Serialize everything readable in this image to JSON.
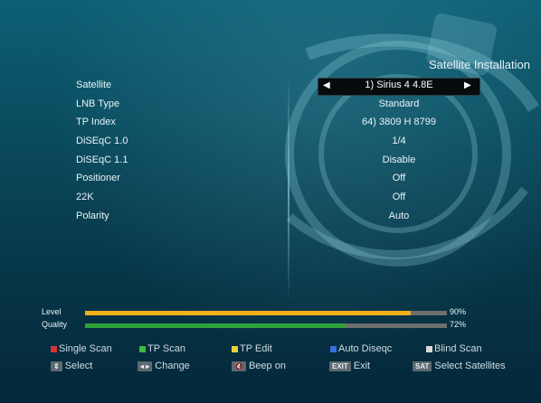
{
  "header": {
    "title": "Satellite Installation"
  },
  "settings": [
    {
      "label": "Satellite",
      "value": "1) Sirius 4 4.8E",
      "selected": true
    },
    {
      "label": "LNB Type",
      "value": "Standard"
    },
    {
      "label": "TP Index",
      "value": "64) 3809 H 8799"
    },
    {
      "label": "DiSEqC 1.0",
      "value": "1/4"
    },
    {
      "label": "DiSEqC 1.1",
      "value": "Disable"
    },
    {
      "label": "Positioner",
      "value": "Off"
    },
    {
      "label": "22K",
      "value": "Off"
    },
    {
      "label": "Polarity",
      "value": "Auto"
    }
  ],
  "meters": {
    "level": {
      "label": "Level",
      "percent_text": "90%",
      "value": 0.9,
      "color": "#f2b01d"
    },
    "quality": {
      "label": "Quality",
      "percent_text": "72%",
      "value": 0.72,
      "color": "#2fa33a"
    }
  },
  "help": {
    "colored": [
      {
        "label": "Single Scan",
        "color": "#d53535",
        "icon": "red-square-icon"
      },
      {
        "label": "TP Scan",
        "color": "#3dbb3d",
        "icon": "green-square-icon"
      },
      {
        "label": "TP Edit",
        "color": "#e3d33a",
        "icon": "yellow-square-icon"
      },
      {
        "label": "Auto Diseqc",
        "color": "#3a6fe0",
        "icon": "blue-square-icon"
      },
      {
        "label": "Blind Scan",
        "color": "#d8d8d8",
        "icon": "white-square-icon"
      }
    ],
    "keys": [
      {
        "key": "⇕",
        "label": "Select"
      },
      {
        "key": "◂ ▸",
        "label": "Change"
      },
      {
        "key": "🔇",
        "label": "Beep on"
      },
      {
        "key": "EXIT",
        "label": "Exit"
      },
      {
        "key": "SAT",
        "label": "Select Satellites"
      }
    ]
  },
  "colors": {
    "accent": "#f2b01d",
    "background": "#0a4a5d"
  }
}
